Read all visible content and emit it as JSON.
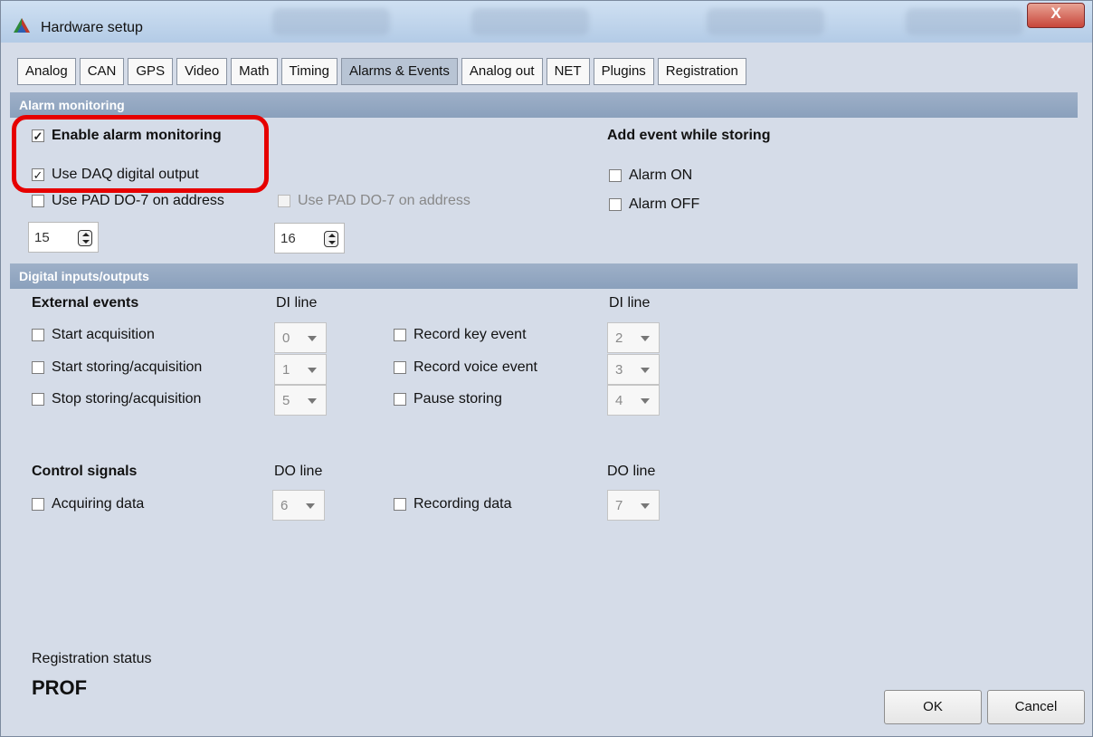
{
  "window": {
    "title": "Hardware setup",
    "close_label": "X"
  },
  "tabs": [
    {
      "label": "Analog",
      "active": false
    },
    {
      "label": "CAN",
      "active": false
    },
    {
      "label": "GPS",
      "active": false
    },
    {
      "label": "Video",
      "active": false
    },
    {
      "label": "Math",
      "active": false
    },
    {
      "label": "Timing",
      "active": false
    },
    {
      "label": "Alarms & Events",
      "active": true
    },
    {
      "label": "Analog out",
      "active": false
    },
    {
      "label": "NET",
      "active": false
    },
    {
      "label": "Plugins",
      "active": false
    },
    {
      "label": "Registration",
      "active": false
    }
  ],
  "alarm_monitoring": {
    "header": "Alarm monitoring",
    "enable": {
      "label": "Enable alarm monitoring",
      "checked": true
    },
    "use_daq": {
      "label": "Use DAQ digital output",
      "checked": true
    },
    "use_pad_1": {
      "label": "Use PAD DO-7 on address",
      "checked": false
    },
    "use_pad_2": {
      "label": "Use PAD DO-7 on address",
      "checked": false,
      "disabled": true
    },
    "address_1": "15",
    "address_2": "16",
    "add_event_title": "Add event while storing",
    "alarm_on": {
      "label": "Alarm ON",
      "checked": false
    },
    "alarm_off": {
      "label": "Alarm OFF",
      "checked": false
    }
  },
  "digital_io": {
    "header": "Digital inputs/outputs",
    "external_events_title": "External events",
    "di_line_label": "DI line",
    "di_line_label_2": "DI line",
    "start_acq": {
      "label": "Start acquisition",
      "line": "0"
    },
    "start_storing": {
      "label": "Start storing/acquisition",
      "line": "1"
    },
    "stop_storing": {
      "label": "Stop storing/acquisition",
      "line": "5"
    },
    "record_key": {
      "label": "Record key event",
      "line": "2"
    },
    "record_voice": {
      "label": "Record voice event",
      "line": "3"
    },
    "pause_storing": {
      "label": "Pause storing",
      "line": "4"
    },
    "control_signals_title": "Control signals",
    "do_line_label": "DO line",
    "do_line_label_2": "DO line",
    "acquiring": {
      "label": "Acquiring data",
      "line": "6"
    },
    "recording": {
      "label": "Recording data",
      "line": "7"
    }
  },
  "registration": {
    "status_label": "Registration status",
    "status_value": "PROF"
  },
  "buttons": {
    "ok": "OK",
    "cancel": "Cancel"
  },
  "colors": {
    "highlight": "#e60000",
    "section_header": "#8fa3bf",
    "background": "#d5dce8"
  }
}
